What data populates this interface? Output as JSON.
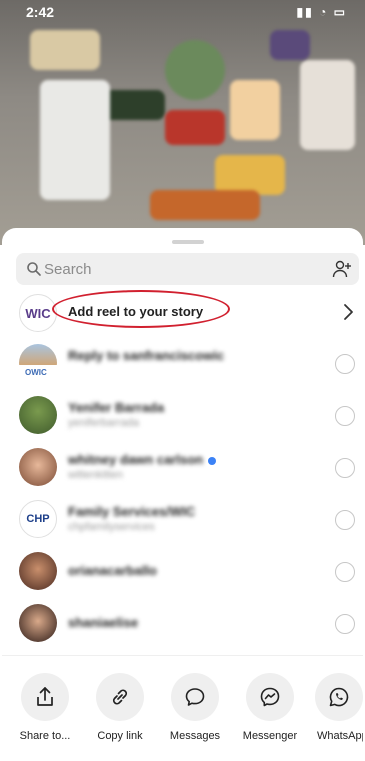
{
  "status_bar": {
    "time": "2:42",
    "icons": "signal-wifi-battery"
  },
  "search": {
    "placeholder": "Search",
    "value": ""
  },
  "story_row": {
    "label": "Add reel to your story",
    "logo_text": "WIC"
  },
  "contacts": [
    {
      "name": "Reply to sanfranciscowic",
      "subtitle": "",
      "avatar_text": ""
    },
    {
      "name": "Yenifer Barrada",
      "subtitle": "yeniferbarrada",
      "avatar_text": ""
    },
    {
      "name": "whitney dawn carlson",
      "subtitle": "wittenkitten",
      "avatar_text": "",
      "verified": true
    },
    {
      "name": "Family Services/WIC",
      "subtitle": "chpfamilyservices",
      "avatar_text": "CHP"
    },
    {
      "name": "orianacarballo",
      "subtitle": "",
      "avatar_text": ""
    },
    {
      "name": "shaniaelise",
      "subtitle": "",
      "avatar_text": ""
    }
  ],
  "actions": [
    {
      "label": "Share to...",
      "icon": "share-icon"
    },
    {
      "label": "Copy link",
      "icon": "link-icon"
    },
    {
      "label": "Messages",
      "icon": "message-bubble-icon"
    },
    {
      "label": "Messenger",
      "icon": "messenger-icon"
    },
    {
      "label": "WhatsApp",
      "icon": "whatsapp-icon"
    }
  ],
  "colors": {
    "highlight": "#d1202f",
    "verified": "#3b82f6",
    "search_bg": "#efefef"
  }
}
